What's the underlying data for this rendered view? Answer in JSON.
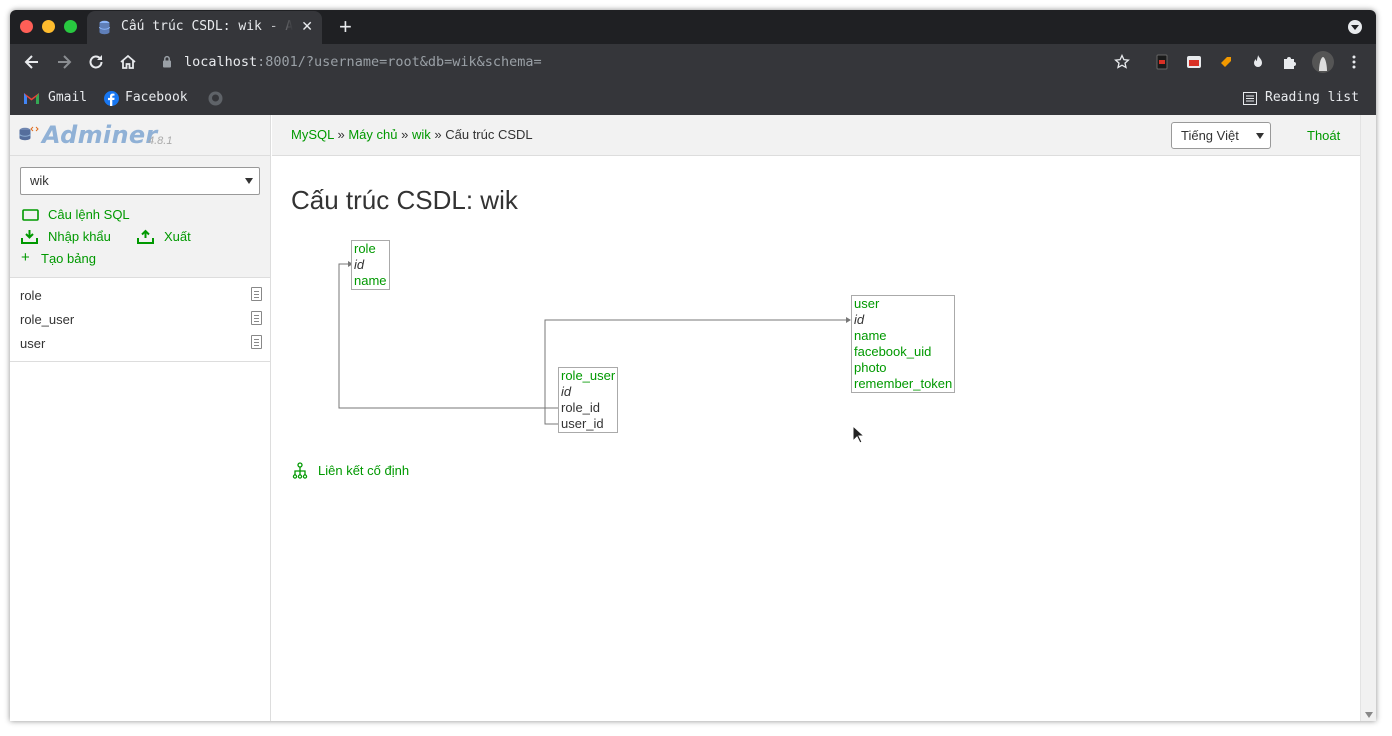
{
  "browser": {
    "tab_title": "Cấu trúc CSDL: wik - Adminer",
    "url_host": "localhost",
    "url_rest": ":8001/?username=root&db=wik&schema=",
    "bookmarks": [
      {
        "label": "Gmail",
        "icon": "gmail-icon"
      },
      {
        "label": "Facebook",
        "icon": "facebook-icon"
      },
      {
        "label": "",
        "icon": "github-icon"
      }
    ],
    "reading_list": "Reading list",
    "colors": {
      "tabstrip": "#1f2023",
      "toolbar": "#35363a",
      "close": "#ff5f57",
      "minimize": "#febc2e",
      "maximize": "#28c840"
    }
  },
  "sidebar": {
    "logo": "Adminer",
    "version": "4.8.1",
    "db_select": "wik",
    "links": {
      "sql": "Câu lệnh SQL",
      "import": "Nhập khẩu",
      "export": "Xuất",
      "create_table": "Tạo bảng"
    },
    "tables": [
      "role",
      "role_user",
      "user"
    ]
  },
  "breadcrumb": {
    "items": [
      "MySQL",
      "Máy chủ",
      "wik"
    ],
    "separator": "»",
    "current": "Cấu trúc CSDL",
    "language": "Tiếng Việt",
    "logout": "Thoát"
  },
  "page": {
    "title": "Cấu trúc CSDL: wik",
    "fixed_links": "Liên kết cố định",
    "accent": "#009900"
  },
  "schema": {
    "role": {
      "name": "role",
      "fields": [
        "id",
        "name"
      ]
    },
    "role_user": {
      "name": "role_user",
      "fields": [
        "id",
        "role_id",
        "user_id"
      ]
    },
    "user": {
      "name": "user",
      "fields": [
        "id",
        "name",
        "facebook_uid",
        "photo",
        "remember_token"
      ]
    }
  }
}
